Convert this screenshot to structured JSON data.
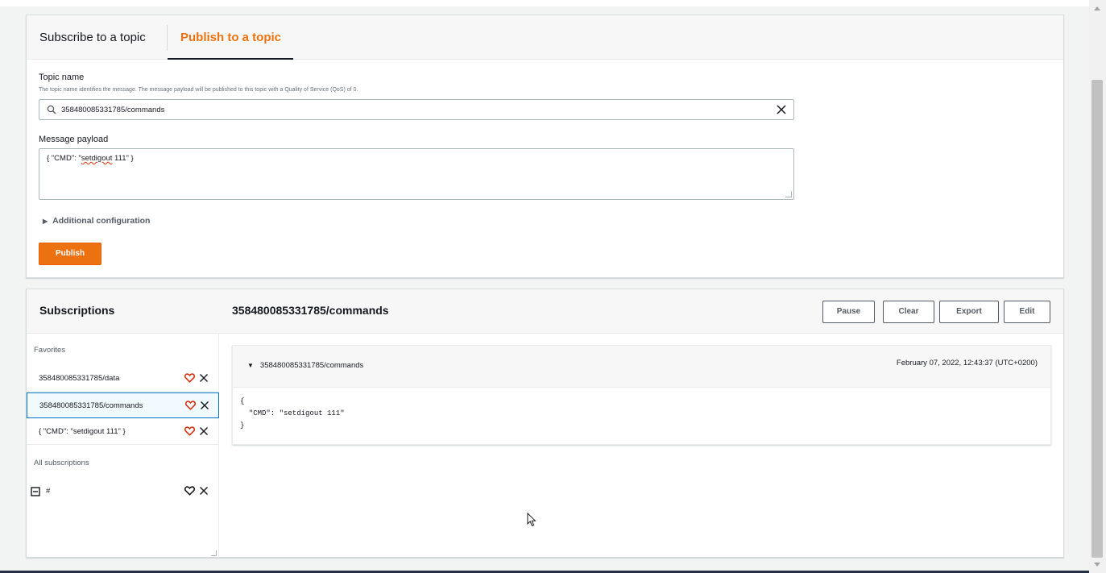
{
  "publish_panel": {
    "tabs": [
      {
        "label": "Subscribe to a topic",
        "active": false
      },
      {
        "label": "Publish to a topic",
        "active": true
      }
    ],
    "topic_name_label": "Topic name",
    "topic_name_description": "The topic name identifies the message. The message payload will be published to this topic with a Quality of Service (QoS) of 0.",
    "topic_value": "358480085331785/commands",
    "payload_label": "Message payload",
    "payload_prefix": "{ \"CMD\": \"",
    "payload_misspelled": "setdigout",
    "payload_suffix": " 111\" }",
    "additional_config_label": "Additional configuration",
    "publish_button": "Publish"
  },
  "subscriptions_panel": {
    "title": "Subscriptions",
    "selected_topic": "358480085331785/commands",
    "buttons": {
      "pause": "Pause",
      "clear": "Clear",
      "export": "Export",
      "edit": "Edit"
    },
    "favorites_label": "Favorites",
    "favorites": [
      {
        "name": "358480085331785/data",
        "selected": false
      },
      {
        "name": "358480085331785/commands",
        "selected": true
      },
      {
        "name": "{ \"CMD\": \"setdigout 111\" }",
        "selected": false
      }
    ],
    "all_subscriptions_label": "All subscriptions",
    "all_subscriptions": [
      {
        "name": "#"
      }
    ],
    "message": {
      "topic": "358480085331785/commands",
      "timestamp": "February 07, 2022, 12:43:37 (UTC+0200)",
      "body_open": "{",
      "body_line": "  \"CMD\": \"setdigout 111\"",
      "body_close": "}"
    }
  },
  "colors": {
    "accent": "#ec7211",
    "selected_border": "#0073bb",
    "text": "#16191f",
    "muted": "#545b64",
    "favorite_heart": "#d13212"
  },
  "icons": {
    "search": "search-icon",
    "clear": "close-icon",
    "heart": "heart-icon",
    "remove": "close-icon",
    "expand": "caret-down-icon",
    "collapse_box": "minus-square-icon",
    "cursor": "mouse-pointer-icon"
  }
}
